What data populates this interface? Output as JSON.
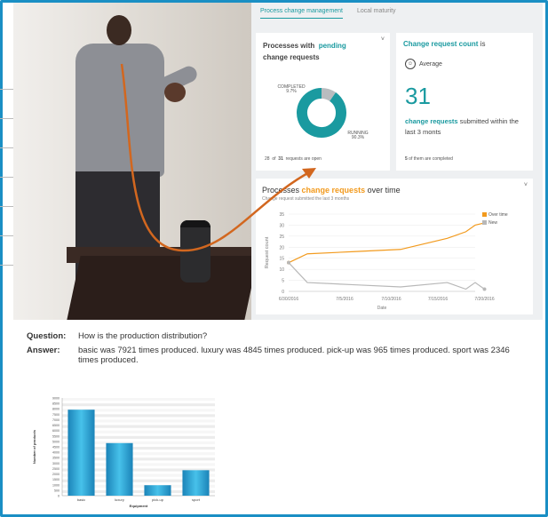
{
  "dashboard": {
    "tabs": [
      {
        "label": "Process change management",
        "active": true
      },
      {
        "label": "Local maturity",
        "active": false
      }
    ],
    "pending_card": {
      "title_prefix": "Processes with",
      "title_highlight": "pending",
      "title_suffix": "change requests",
      "menu": "˅",
      "completed_label": "COMPLETED",
      "completed_pct": "9.7%",
      "completed_value": 9.7,
      "running_label": "RUNNING",
      "running_pct": "90.3%",
      "running_value": 90.3,
      "footer_count": "28",
      "footer_of": "of",
      "footer_total": "31",
      "footer_text": "requests are open"
    },
    "count_card": {
      "title_highlight": "Change request count",
      "title_suffix": " is",
      "status_icon": "smiley-icon",
      "status_label": "Average",
      "big_number": "31",
      "desc_highlight": "change requests",
      "desc_rest": " submitted within the last 3 monts",
      "footer_num": "5",
      "footer_text": " of them are completed"
    },
    "time_card": {
      "title_prefix": "Processes",
      "title_highlight": "change requests",
      "title_suffix": "over time",
      "subtitle": "Change request submitted the last 3 months",
      "menu": "˅"
    }
  },
  "question_label": "Question:",
  "question_text": "How is the production distribution?",
  "answer_label": "Answer:",
  "answer_text": "basic was 7921 times produced. luxury was 4845 times produced. pick-up was 965 times produced. sport was 2346 times produced.",
  "colors": {
    "teal": "#1a9aa0",
    "orange": "#f29a1d",
    "border": "#1a8fc4",
    "arrow": "#d2671f"
  },
  "chart_data": [
    {
      "type": "pie",
      "labels": [
        "COMPLETED",
        "RUNNING"
      ],
      "values": [
        9.7,
        90.3
      ]
    },
    {
      "type": "line",
      "ylabel": "Request count",
      "xlabel": "Date",
      "x": [
        "6/30/2016",
        "7/1/2016",
        "7/6/2016",
        "7/11/2016",
        "7/16/2016",
        "7/18/2016",
        "7/19/2016",
        "7/20/2016"
      ],
      "xticks": [
        "6/30/2016",
        "7/5/2016",
        "7/10/2016",
        "7/15/2016",
        "7/20/2016"
      ],
      "yticks": [
        0,
        5,
        10,
        15,
        20,
        25,
        30,
        35
      ],
      "ylim": [
        0,
        35
      ],
      "series": [
        {
          "name": "Over time",
          "color": "#f29a1d",
          "values": [
            13,
            17,
            18,
            19,
            24,
            27,
            30,
            31
          ]
        },
        {
          "name": "New",
          "color": "#b8b8b8",
          "values": [
            13,
            4,
            3,
            2,
            4,
            1,
            4,
            1
          ]
        }
      ],
      "legend": "top-right"
    },
    {
      "type": "bar",
      "xlabel": "Equipment",
      "ylabel": "Number of products",
      "categories": [
        "basic",
        "luxury",
        "pick-up",
        "sport"
      ],
      "values": [
        7921,
        4845,
        965,
        2346
      ],
      "ylim": [
        0,
        9000
      ],
      "yticks": [
        0,
        500,
        1000,
        1500,
        2000,
        2500,
        3000,
        3500,
        4000,
        4500,
        5000,
        5500,
        6000,
        6500,
        7000,
        7500,
        8000,
        8500,
        9000
      ],
      "color": "#2aa7d8"
    }
  ]
}
